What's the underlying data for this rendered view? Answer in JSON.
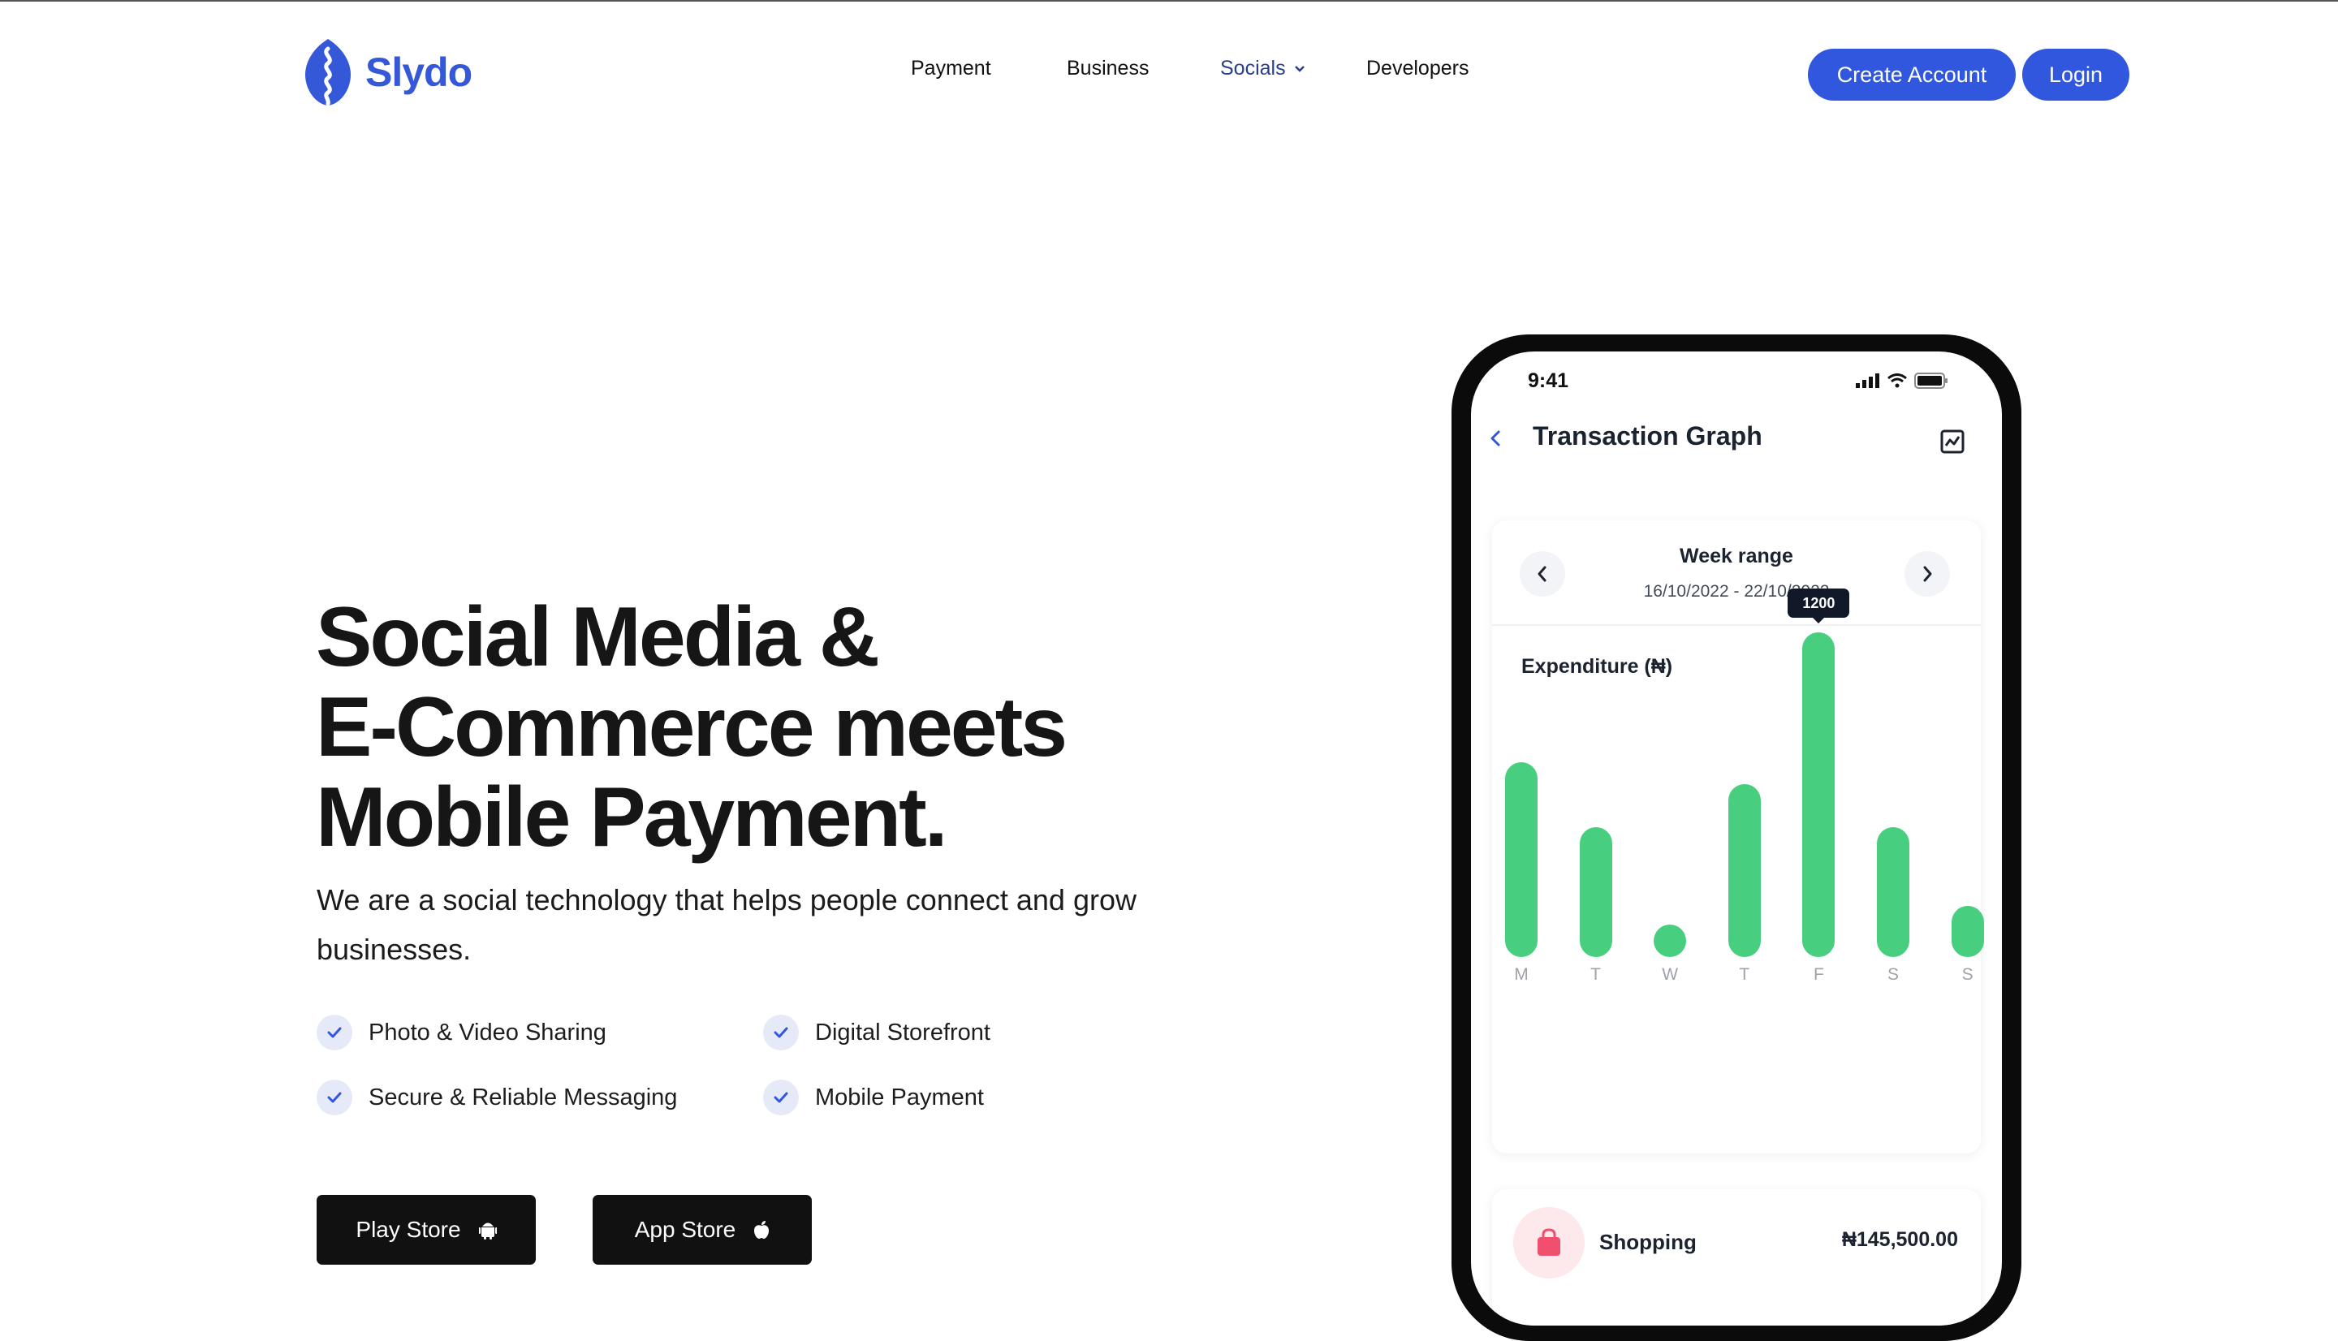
{
  "brand": {
    "name": "Slydo",
    "color": "#3458d8"
  },
  "nav": {
    "payment": "Payment",
    "business": "Business",
    "socials": "Socials",
    "developers": "Developers"
  },
  "auth": {
    "create_account": "Create Account",
    "login": "Login"
  },
  "hero": {
    "title_line1": "Social Media &",
    "title_line2": "E-Commerce meets",
    "title_line3": "Mobile Payment.",
    "subtitle": "We are a social technology that helps people connect and grow businesses."
  },
  "features": [
    "Photo & Video Sharing",
    "Secure & Reliable Messaging",
    "Digital Storefront",
    "Mobile Payment"
  ],
  "stores": {
    "play": "Play Store",
    "app": "App Store"
  },
  "phone": {
    "time": "9:41",
    "screen_title": "Transaction Graph",
    "week_label": "Week range",
    "week_dates": "16/10/2022 - 22/10/2022",
    "chart_label": "Expenditure (₦)",
    "transaction": {
      "name": "Shopping",
      "amount": "₦145,500.00"
    }
  },
  "chart_data": {
    "type": "bar",
    "title": "Expenditure (₦)",
    "categories": [
      "M",
      "T",
      "W",
      "T",
      "F",
      "S",
      "S"
    ],
    "values": [
      720,
      480,
      120,
      640,
      1200,
      480,
      190
    ],
    "highlight_label": "1200",
    "highlight_index": 4,
    "ylim": [
      0,
      1200
    ],
    "grid": false,
    "bar_color": "#47cf7f"
  },
  "colors": {
    "accent": "#3157de",
    "dark_button": "#111111",
    "bar": "#47cf7f"
  }
}
